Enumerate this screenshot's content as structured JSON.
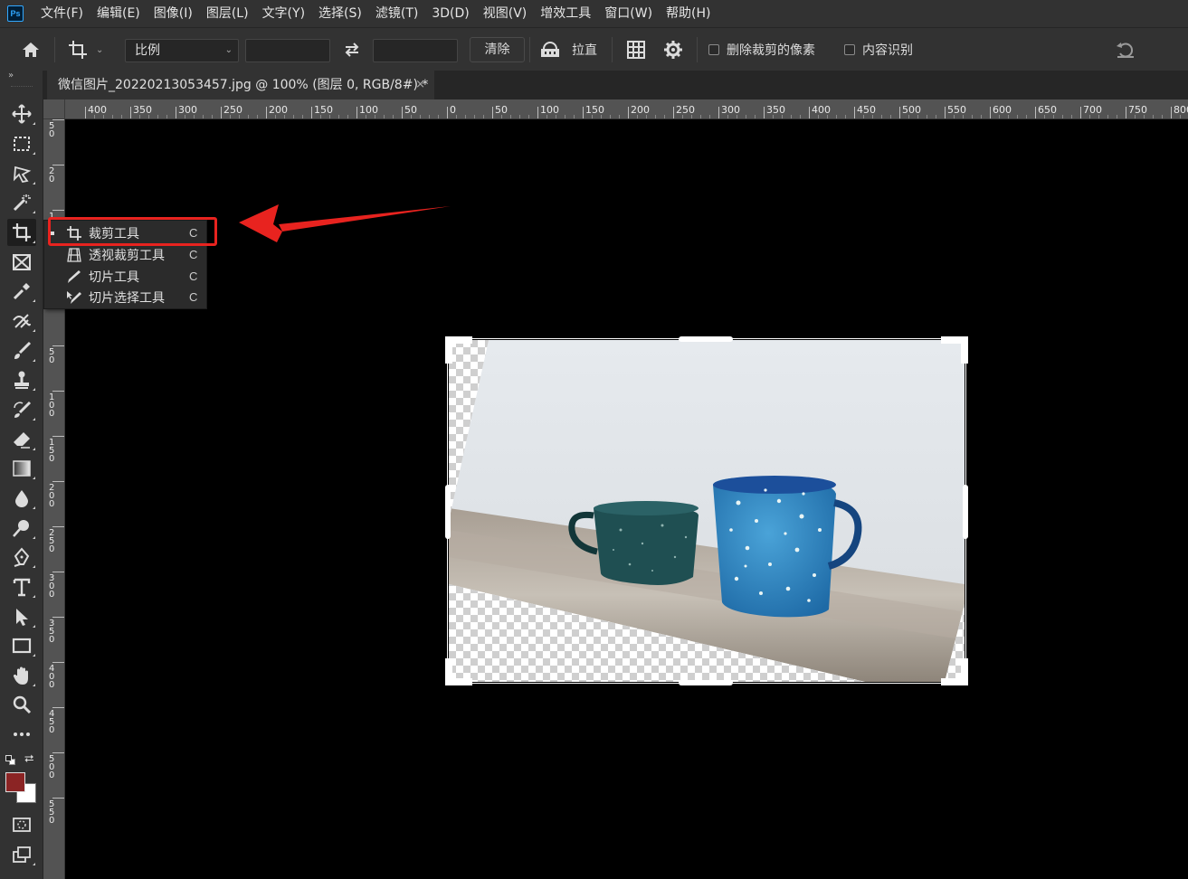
{
  "app": {
    "logo": "Ps"
  },
  "menu": [
    "文件(F)",
    "编辑(E)",
    "图像(I)",
    "图层(L)",
    "文字(Y)",
    "选择(S)",
    "滤镜(T)",
    "3D(D)",
    "视图(V)",
    "增效工具",
    "窗口(W)",
    "帮助(H)"
  ],
  "options": {
    "ratio_select": "比例",
    "width_value": "",
    "height_value": "",
    "clear_label": "清除",
    "straighten_label": "拉直",
    "delete_cropped_label": "删除裁剪的像素",
    "delete_cropped_checked": false,
    "content_aware_label": "内容识别",
    "content_aware_checked": false
  },
  "document": {
    "tab_title": "微信图片_20220213053457.jpg @ 100% (图层 0, RGB/8#) *",
    "close": "×"
  },
  "ruler_h_labels": [
    "400",
    "350",
    "300",
    "250",
    "200",
    "150",
    "100",
    "50",
    "0",
    "50",
    "100",
    "150",
    "200",
    "250",
    "300",
    "350",
    "400",
    "450",
    "500",
    "550",
    "600",
    "650",
    "700",
    "750",
    "800"
  ],
  "ruler_v_labels": [
    "50",
    "20",
    "1",
    "",
    "0",
    "50",
    "100",
    "150",
    "200",
    "250",
    "300",
    "350",
    "400",
    "450",
    "500",
    "550"
  ],
  "flyout": [
    {
      "label": "裁剪工具",
      "key": "C",
      "icon": "crop-icon",
      "selected": true
    },
    {
      "label": "透视裁剪工具",
      "key": "C",
      "icon": "perspective-crop-icon",
      "selected": false
    },
    {
      "label": "切片工具",
      "key": "C",
      "icon": "slice-icon",
      "selected": false
    },
    {
      "label": "切片选择工具",
      "key": "C",
      "icon": "slice-select-icon",
      "selected": false
    }
  ],
  "colors": {
    "foreground": "#8b2424",
    "background": "#ffffff",
    "annotation": "#e8231f"
  }
}
